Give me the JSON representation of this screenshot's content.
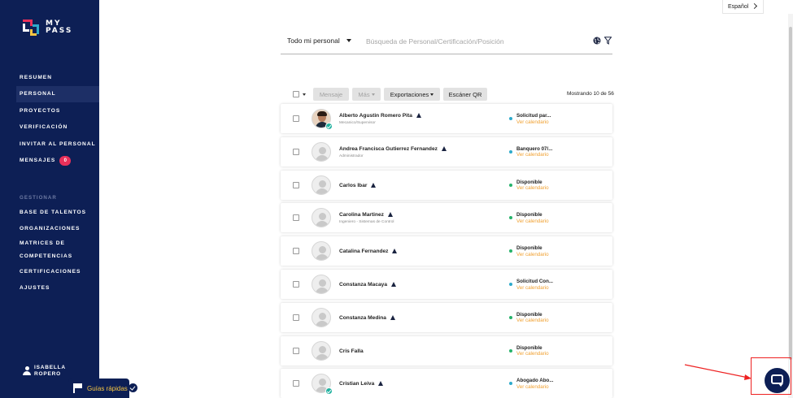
{
  "brand": {
    "name": "MY PASS",
    "line1": "MY",
    "line2": "PASS"
  },
  "language": {
    "label": "Español"
  },
  "sidebar": {
    "items": [
      {
        "label": "RESUMEN"
      },
      {
        "label": "PERSONAL"
      },
      {
        "label": "PROYECTOS"
      },
      {
        "label": "VERIFICACIÓN"
      },
      {
        "label": "INVITAR AL PERSONAL"
      },
      {
        "label": "MENSAJES",
        "badge": "0"
      }
    ],
    "section_label": "GESTIONAR",
    "manage_items": [
      {
        "label": "BASE DE TALENTOS"
      },
      {
        "label": "ORGANIZACIONES"
      },
      {
        "label": "MATRICES DE",
        "label2": "COMPETENCIAS"
      },
      {
        "label": "CERTIFICACIONES"
      },
      {
        "label": "AJUSTES"
      }
    ],
    "user": {
      "line1": "ISABELLA",
      "line2": "ROPERO"
    }
  },
  "guides": {
    "label": "Guías rápidas"
  },
  "search": {
    "filter_value": "Todo mi personal",
    "placeholder": "Búsqueda de Personal/Certificación/Posición"
  },
  "toolbar": {
    "message_label": "Mensaje",
    "more_label": "Más",
    "exports_label": "Exportaciones",
    "qr_label": "Escáner QR",
    "showing": "Mostrando 10 de 56"
  },
  "people": [
    {
      "name": "Alberto Agustin Romero Pita",
      "role": "Mecanico/Supervisor",
      "status": "Solicitud par...",
      "status_color": "#2eaacb",
      "calendar": "Ver calendario",
      "photo": true,
      "verified": true
    },
    {
      "name": "Andrea Francisca Gutierrez Fernandez",
      "role": "Administrador",
      "status": "Banquero 07/...",
      "status_color": "#2eaacb",
      "calendar": "Ver calendario",
      "photo": false,
      "verified": false
    },
    {
      "name": "Carlos Ibar",
      "role": "",
      "status": "Disponible",
      "status_color": "#27b36b",
      "calendar": "Ver calendario",
      "photo": false,
      "verified": false
    },
    {
      "name": "Carolina Martinez",
      "role": "Ingeniero - Sistemas de Control",
      "status": "Disponible",
      "status_color": "#27b36b",
      "calendar": "Ver calendario",
      "photo": false,
      "verified": false
    },
    {
      "name": "Catalina Fernandez",
      "role": "",
      "status": "Disponible",
      "status_color": "#27b36b",
      "calendar": "Ver calendario",
      "photo": false,
      "verified": false
    },
    {
      "name": "Constanza Macaya",
      "role": "",
      "status": "Solicitud Con...",
      "status_color": "#2eaacb",
      "calendar": "Ver calendario",
      "photo": false,
      "verified": false
    },
    {
      "name": "Constanza Medina",
      "role": "",
      "status": "Disponible",
      "status_color": "#27b36b",
      "calendar": "Ver calendario",
      "photo": false,
      "verified": false
    },
    {
      "name": "Cris Falla",
      "role": "",
      "status": "Disponible",
      "status_color": "#27b36b",
      "calendar": "Ver calendario",
      "photo": false,
      "verified": false,
      "no_warn": true
    },
    {
      "name": "Cristian Leiva",
      "role": "",
      "status": "Abogado Abo...",
      "status_color": "#2eaacb",
      "calendar": "Ver calendario",
      "photo": false,
      "verified": true
    }
  ],
  "icons": {
    "globe": "globe-icon",
    "filter": "filter-icon",
    "warning": "warning-icon",
    "chat": "chat-icon",
    "flag": "flag-icon"
  },
  "colors": {
    "sidebar_bg": "#0d1f55",
    "accent_orange": "#f0a030",
    "badge_red": "#e8305a",
    "highlight_red": "#ee2222"
  }
}
